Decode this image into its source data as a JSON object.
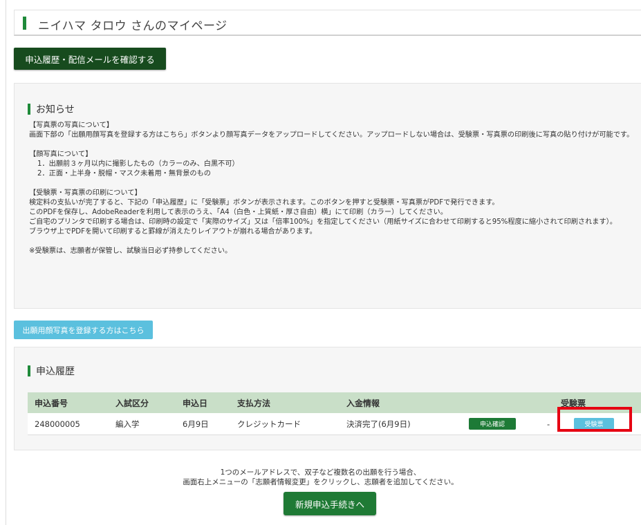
{
  "header": {
    "title": "ニイハマ タロウ さんのマイページ"
  },
  "buttons": {
    "history_mail": "申込履歴・配信メールを確認する",
    "register_photo": "出願用顔写真を登録する方はこちら",
    "new_application": "新規申込手続きへ"
  },
  "notice": {
    "heading": "お知らせ",
    "lines": [
      "【写真票の写真について】",
      "画面下部の「出願用顔写真を登録する方はこちら」ボタンより顔写真データをアップロードしてください。アップロードしない場合は、受験票・写真票の印刷後に写真の貼り付けが可能です。",
      "【顔写真について】",
      "1．出願前３ヶ月以内に撮影したもの（カラーのみ、白黒不可）",
      "2．正面・上半身・脱帽・マスク未着用・無背景のもの",
      "【受験票・写真票の印刷について】",
      "検定料の支払いが完了すると、下記の「申込履歴」に「受験票」ボタンが表示されます。このボタンを押すと受験票・写真票がPDFで発行できます。",
      "このPDFを保存し、AdobeReaderを利用して表示のうえ、「A4（白色・上質紙・厚さ自由）横」にて印刷（カラー）してください。",
      "ご自宅のプリンタで印刷する場合は、印刷時の設定で「実際のサイズ」又は「倍率100%」を指定してください（用紙サイズに合わせて印刷すると95%程度に縮小されて印刷されます）。",
      "ブラウザ上でPDFを開いて印刷すると罫線が消えたりレイアウトが崩れる場合があります。",
      "※受験票は、志願者が保管し、試験当日必ず持参してください。"
    ]
  },
  "history": {
    "heading": "申込履歴",
    "columns": [
      "申込番号",
      "入試区分",
      "申込日",
      "支払方法",
      "入金情報",
      "受験票"
    ],
    "rows": [
      {
        "number": "248000005",
        "category": "編入学",
        "date": "6月9日",
        "payment_method": "クレジットカード",
        "payment_status": "決済完了(6月9日)",
        "confirm_button": "申込確認",
        "dash": "-",
        "ticket_button": "受験票"
      }
    ]
  },
  "footer": {
    "line1": "1つのメールアドレスで、双子など複数名の出願を行う場合、",
    "line2": "画面右上メニューの「志願者情報変更」をクリックし、志願者を追加してください。"
  },
  "colors": {
    "accent_green": "#1f8a3a",
    "dark_button": "#174b1e",
    "info_blue": "#5bc0de",
    "table_header": "#c9dfc8",
    "highlight_red": "#e60012"
  }
}
